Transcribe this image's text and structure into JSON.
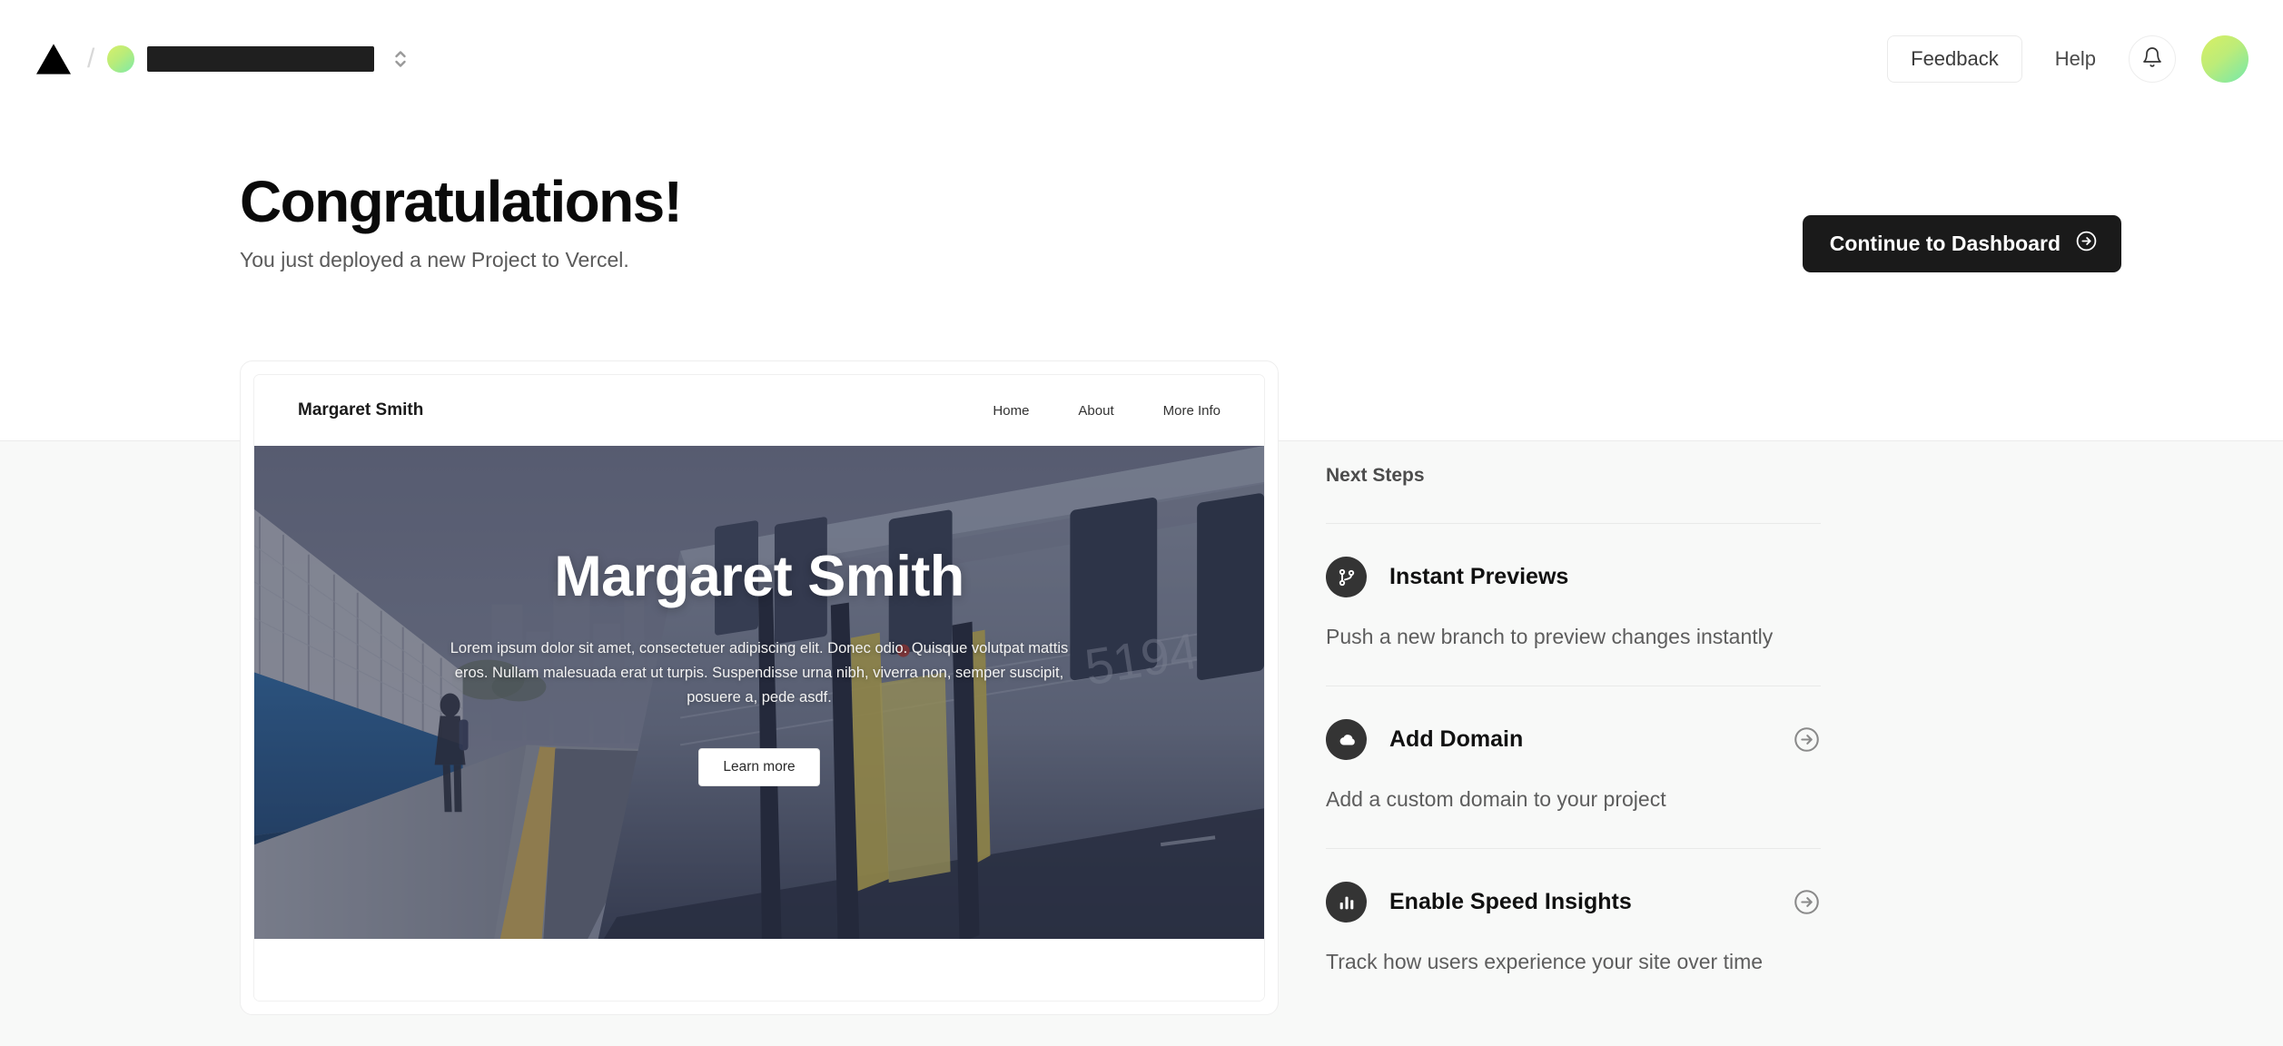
{
  "topnav": {
    "logo_icon": "vercel-triangle-logo",
    "separator": "/",
    "team": {
      "avatar_icon": "team-avatar",
      "name": "",
      "name_redacted": true,
      "selector_icon": "chevron-up-down-icon"
    },
    "feedback_label": "Feedback",
    "help_label": "Help",
    "notifications_icon": "bell-icon",
    "user_avatar_icon": "user-avatar"
  },
  "hero": {
    "title": "Congratulations!",
    "subtitle": "You just deployed a new Project to Vercel.",
    "cta_label": "Continue to Dashboard",
    "cta_icon": "arrow-right-circle-icon"
  },
  "preview": {
    "site_brand": "Margaret Smith",
    "nav_links": [
      "Home",
      "About",
      "More Info"
    ],
    "hero_title": "Margaret Smith",
    "hero_paragraph": "Lorem ipsum dolor sit amet, consectetuer adipiscing elit. Donec odio. Quisque volutpat mattis eros. Nullam malesuada erat ut turpis. Suspendisse urna nibh, viverra non, semper suscipit, posuere a, pede asdf.",
    "hero_button": "Learn more"
  },
  "next_steps": {
    "title": "Next Steps",
    "items": [
      {
        "label": "Instant Previews",
        "description": "Push a new branch to preview changes instantly",
        "icon": "git-branch-icon",
        "has_arrow": false
      },
      {
        "label": "Add Domain",
        "description": "Add a custom domain to your project",
        "icon": "cloud-icon",
        "has_arrow": true
      },
      {
        "label": "Enable Speed Insights",
        "description": "Track how users experience your site over time",
        "icon": "bar-chart-icon",
        "has_arrow": true
      }
    ]
  },
  "colors": {
    "accent_dark": "#1a1a1a",
    "page_background": "#ffffff",
    "band_background": "#f8f9f8",
    "avatar_gradient_start": "#d9ef63",
    "avatar_gradient_end": "#74e8ac"
  }
}
